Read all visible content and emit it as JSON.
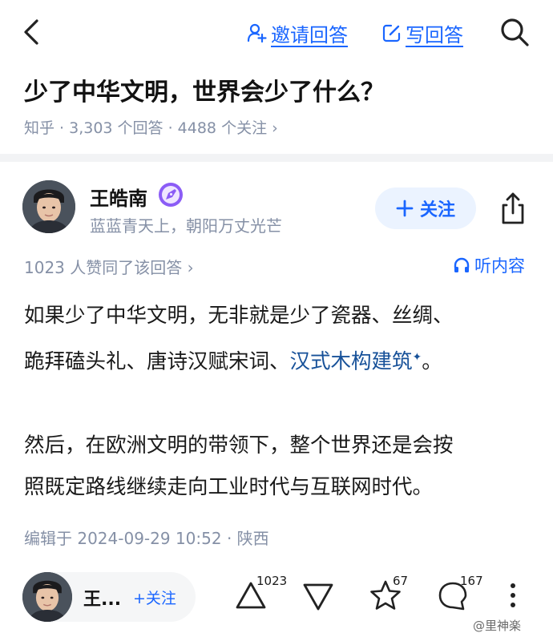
{
  "nav": {
    "invite_label": "邀请回答",
    "write_label": "写回答"
  },
  "question": {
    "title": "少了中华文明，世界会少了什么？",
    "meta": "知乎 · 3,303 个回答 · 4488 个关注 ›"
  },
  "answer": {
    "author_name": "王皓南",
    "author_bio": "蓝蓝青天上，朝阳万丈光芒",
    "follow_label": "关注",
    "votes_text": "1023 人赞同了该回答 ›",
    "listen_label": "听内容",
    "paragraph1_part1": "如果少了中华文明，无非就是少了瓷器、丝绸、",
    "paragraph1_part2": "跪拜磕头礼、唐诗汉赋宋词、",
    "paragraph1_link": "汉式木构建筑",
    "paragraph1_end": "。",
    "paragraph2_line1": "然后，在欧洲文明的带领下，整个世界还是会按",
    "paragraph2_line2": "照既定路线继续走向工业时代与互联网时代。",
    "edit_info": "编辑于 2024-09-29 10:52 · 陕西"
  },
  "bottom_bar": {
    "author_short": "王...",
    "follow_label": "+关注",
    "upvote_count": "1023",
    "star_count": "67",
    "comment_count": "167"
  },
  "watermark": "@里神楽",
  "colors": {
    "accent": "#1a66ff",
    "link": "#175199",
    "meta_gray": "#8590a6",
    "follow_bg": "#ebf3ff",
    "badge_purple": "#8b5cf6"
  },
  "icons": [
    "back-arrow-icon",
    "user-plus-icon",
    "edit-icon",
    "search-icon",
    "pen-badge-icon",
    "plus-icon",
    "share-icon",
    "headphones-icon",
    "upvote-icon",
    "downvote-icon",
    "star-icon",
    "comment-icon",
    "more-icon"
  ]
}
